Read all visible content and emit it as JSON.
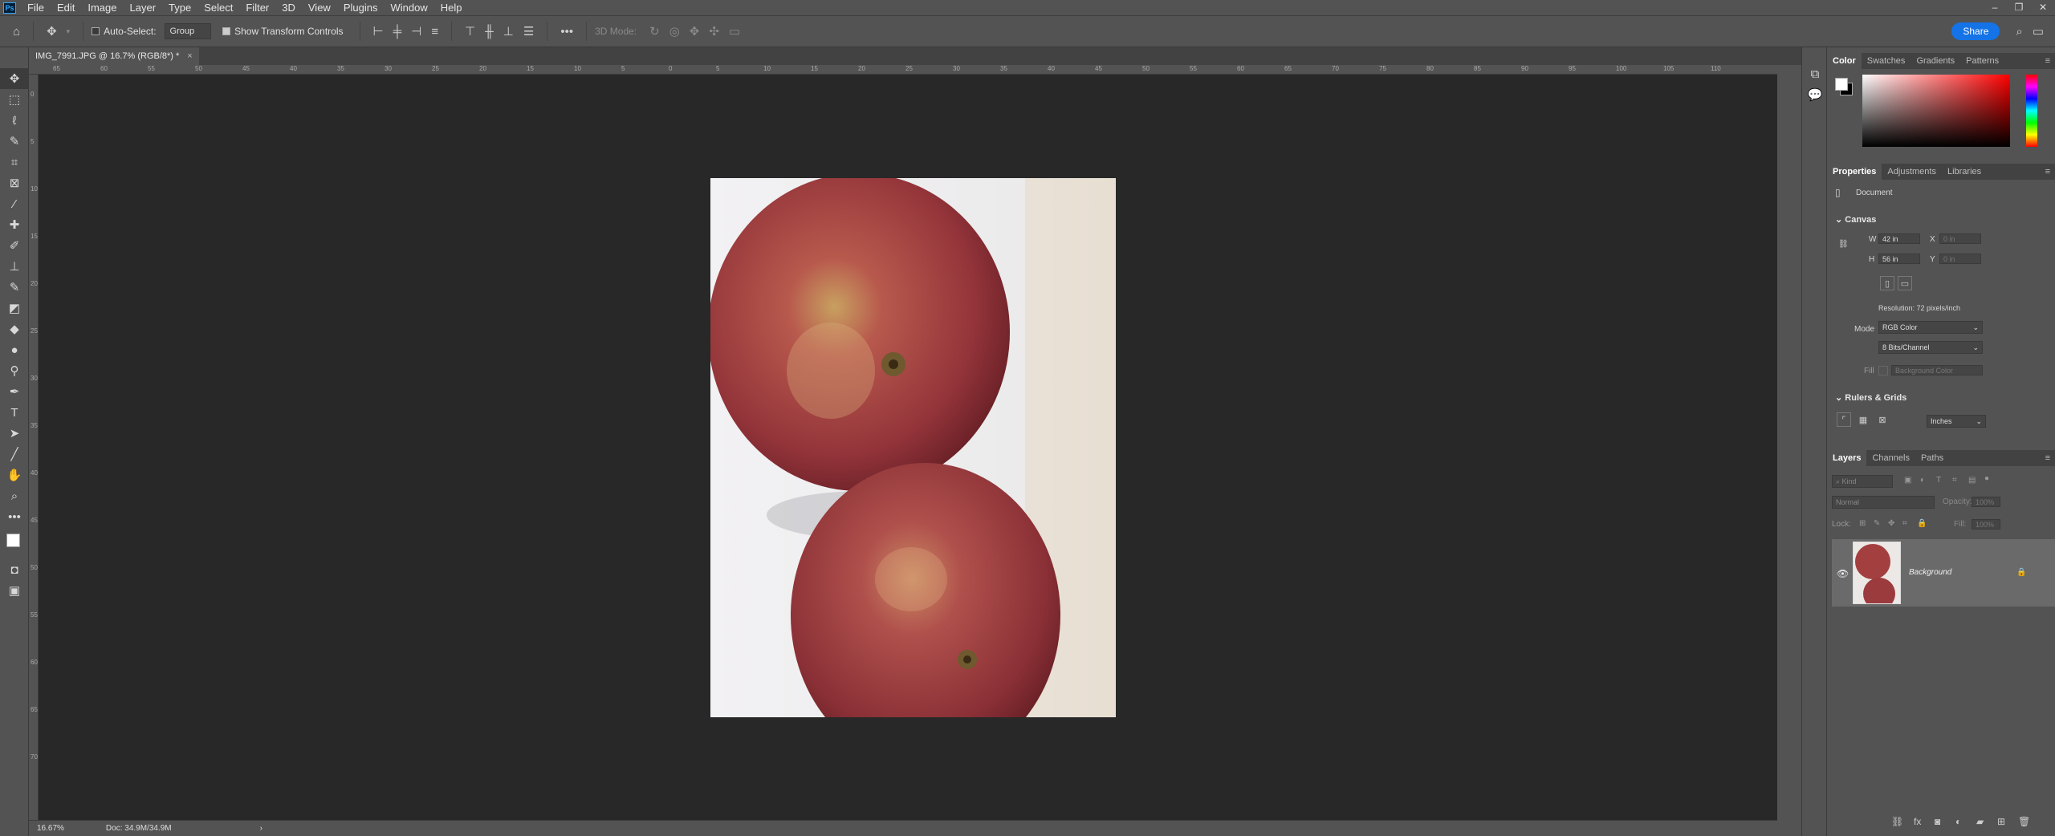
{
  "menu": [
    "File",
    "Edit",
    "Image",
    "Layer",
    "Type",
    "Select",
    "Filter",
    "3D",
    "View",
    "Plugins",
    "Window",
    "Help"
  ],
  "app_logo": "Ps",
  "window_controls": {
    "minimize": "–",
    "restore": "❐",
    "close": "✕"
  },
  "options": {
    "auto_select_label": "Auto-Select:",
    "auto_select_value": "Group",
    "transform_label": "Show Transform Controls",
    "mode_3d_label": "3D Mode:",
    "share_label": "Share"
  },
  "document_tab": {
    "title": "IMG_7991.JPG @ 16.7% (RGB/8*) *",
    "close": "×"
  },
  "rulers": {
    "top": [
      "65",
      "60",
      "55",
      "50",
      "45",
      "40",
      "35",
      "30",
      "25",
      "20",
      "15",
      "10",
      "5",
      "0",
      "5",
      "10",
      "15",
      "20",
      "25",
      "30",
      "35",
      "40",
      "45",
      "50",
      "55",
      "60",
      "65",
      "70",
      "75",
      "80",
      "85",
      "90",
      "95",
      "100",
      "105",
      "110"
    ],
    "left": [
      "0",
      "5",
      "10",
      "15",
      "20",
      "25",
      "30",
      "35",
      "40",
      "45",
      "50",
      "55",
      "60",
      "65",
      "70"
    ]
  },
  "status": {
    "zoom": "16.67%",
    "doc": "Doc: 34.9M/34.9M",
    "arrow": "›"
  },
  "color_panel": {
    "tabs": [
      "Color",
      "Swatches",
      "Gradients",
      "Patterns"
    ]
  },
  "properties_panel": {
    "tabs": [
      "Properties",
      "Adjustments",
      "Libraries"
    ],
    "kind": "Document",
    "canvas_section": "Canvas",
    "w_label": "W",
    "w_value": "42 in",
    "h_label": "H",
    "h_value": "56 in",
    "x_label": "X",
    "x_value": "0 in",
    "y_label": "Y",
    "y_value": "0 in",
    "resolution": "Resolution: 72 pixels/inch",
    "mode_label": "Mode",
    "mode_value": "RGB Color",
    "bits_value": "8 Bits/Channel",
    "fill_label": "Fill",
    "fill_value": "Background Color",
    "rulers_section": "Rulers & Grids",
    "units_value": "Inches"
  },
  "layers_panel": {
    "tabs": [
      "Layers",
      "Channels",
      "Paths"
    ],
    "kind_placeholder": "Kind",
    "blend_mode": "Normal",
    "opacity_label": "Opacity:",
    "opacity_value": "100%",
    "lock_label": "Lock:",
    "fill_label": "Fill:",
    "fill_value": "100%",
    "layer_name": "Background"
  },
  "colors": {
    "accent": "#1473e6",
    "canvas_bg": "#282828",
    "ui_bg": "#535353"
  }
}
